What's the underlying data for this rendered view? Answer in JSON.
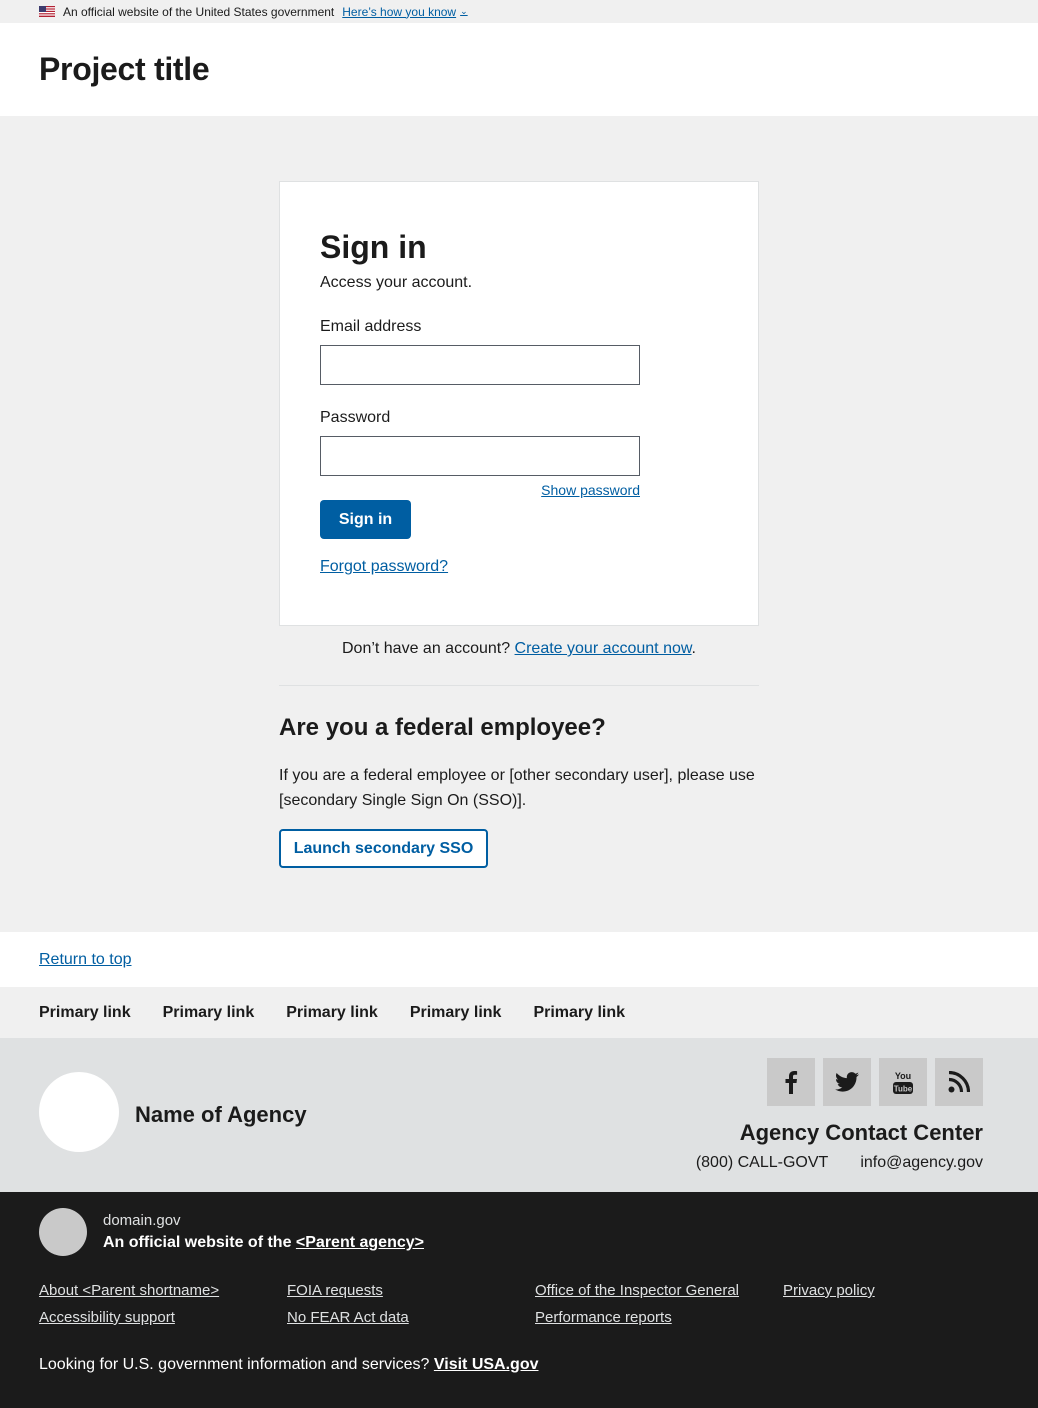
{
  "banner": {
    "text": "An official website of the United States government",
    "how_you_know": "Here’s how you know"
  },
  "header": {
    "title": "Project title"
  },
  "signin": {
    "heading": "Sign in",
    "subheading": "Access your account.",
    "email_label": "Email address",
    "email_value": "",
    "password_label": "Password",
    "password_value": "",
    "show_password": "Show password",
    "submit_label": "Sign in",
    "forgot_label": "Forgot password?"
  },
  "no_account": {
    "text": "Don’t have an account? ",
    "link": "Create your account now",
    "suffix": "."
  },
  "federal": {
    "heading": "Are you a federal employee?",
    "text": "If you are a federal employee or [other secondary user], please use [secondary Single Sign On (SSO)].",
    "button": "Launch secondary SSO"
  },
  "footer": {
    "return_top": "Return to top",
    "primary_links": [
      "Primary link",
      "Primary link",
      "Primary link",
      "Primary link",
      "Primary link"
    ],
    "agency_name": "Name of Agency",
    "social": [
      "facebook-icon",
      "twitter-icon",
      "youtube-icon",
      "rss-icon"
    ],
    "contact_title": "Agency Contact Center",
    "phone": "(800) CALL-GOVT",
    "email": "info@agency.gov"
  },
  "identifier": {
    "domain": "domain.gov",
    "official_prefix": "An official website of the ",
    "parent_agency": "<Parent agency>",
    "links": [
      "About <Parent shortname>",
      "FOIA requests",
      "Office of the Inspector General",
      "Privacy policy",
      "Accessibility support",
      "No FEAR Act data",
      "Performance reports"
    ],
    "usa_text": "Looking for U.S. government information and services? ",
    "usa_link": "Visit USA.gov"
  },
  "colors": {
    "primary": "#005ea2",
    "base_lightest": "#f0f0f0",
    "base_lighter": "#dfe1e2",
    "ink": "#1b1b1b"
  }
}
